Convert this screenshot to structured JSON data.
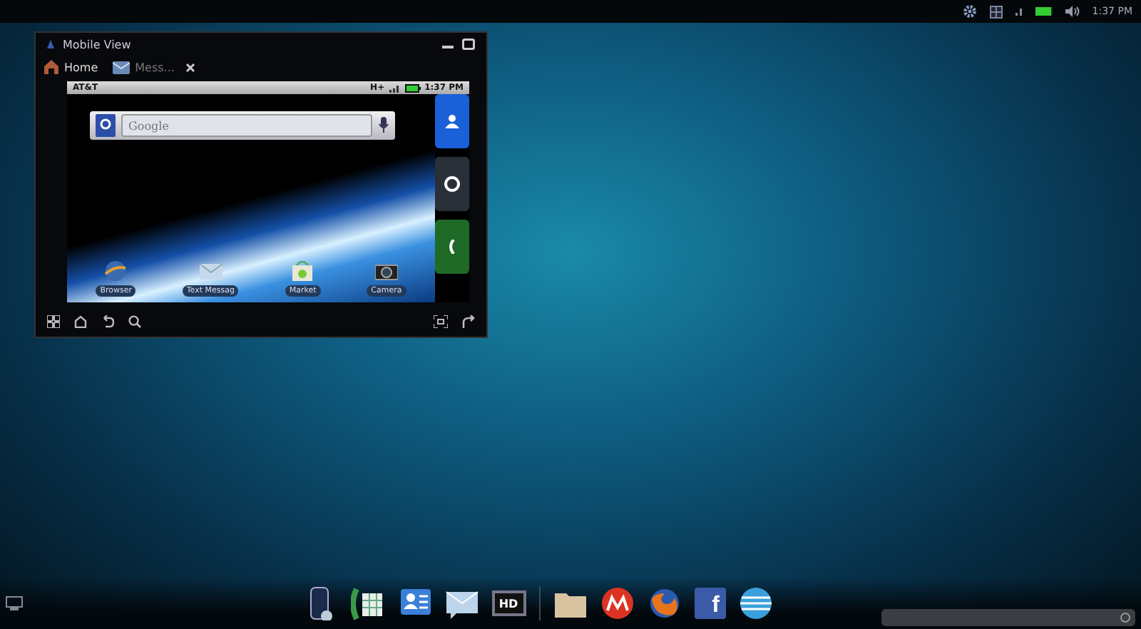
{
  "status_bar": {
    "time": "1:37 PM"
  },
  "window": {
    "title": "Mobile View",
    "tabs": [
      {
        "label": "Home",
        "selected": true
      },
      {
        "label": "Mess...",
        "selected": false
      }
    ],
    "phone": {
      "carrier": "AT&T",
      "network": "H+",
      "time": "1:37 PM",
      "search_placeholder": "Google",
      "apps": [
        {
          "kind": "browser",
          "label": "Browser"
        },
        {
          "kind": "mail",
          "label": "Text Messag"
        },
        {
          "kind": "market",
          "label": "Market"
        },
        {
          "kind": "camera",
          "label": "Camera"
        }
      ]
    }
  },
  "dock": {
    "items": [
      {
        "kind": "phone"
      },
      {
        "kind": "dialer"
      },
      {
        "kind": "contacts"
      },
      {
        "kind": "mail"
      },
      {
        "kind": "hd",
        "label": "HD"
      },
      {
        "kind": "divider"
      },
      {
        "kind": "folder"
      },
      {
        "kind": "motorola"
      },
      {
        "kind": "firefox"
      },
      {
        "kind": "facebook",
        "label": "f"
      },
      {
        "kind": "globe"
      }
    ]
  }
}
